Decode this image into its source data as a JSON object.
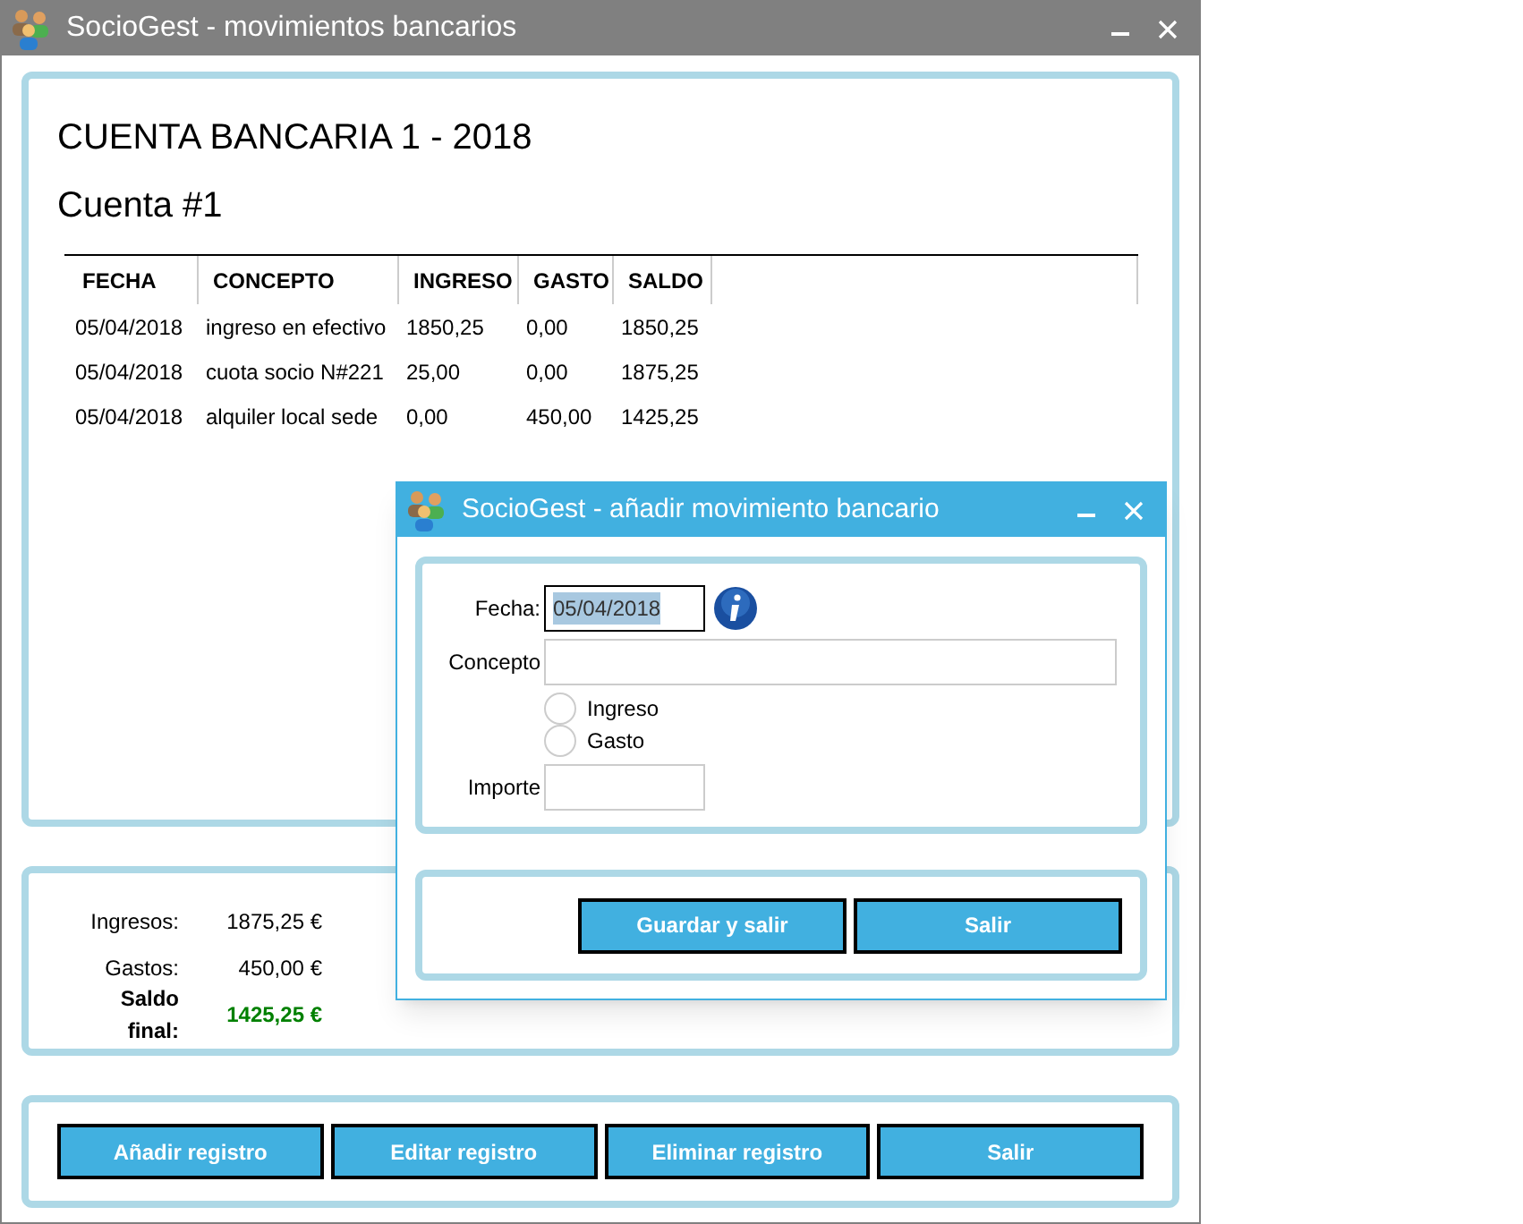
{
  "window": {
    "title": "SocioGest - movimientos bancarios"
  },
  "account_title": "CUENTA BANCARIA 1 - 2018",
  "account_subtitle": "Cuenta #1",
  "table": {
    "columns": [
      "FECHA",
      "CONCEPTO",
      "INGRESO",
      "GASTO",
      "SALDO"
    ],
    "rows": [
      [
        "05/04/2018",
        "ingreso en efectivo",
        "1850,25",
        "0,00",
        "1850,25"
      ],
      [
        "05/04/2018",
        "cuota socio N#221",
        "25,00",
        "0,00",
        "1875,25"
      ],
      [
        "05/04/2018",
        "alquiler local sede",
        "0,00",
        "450,00",
        "1425,25"
      ]
    ]
  },
  "summary": [
    {
      "label": "Ingresos:",
      "value": "1875,25 €",
      "kind": "normal"
    },
    {
      "label": "Gastos:",
      "value": "450,00 €",
      "kind": "normal"
    },
    {
      "label": "Saldo final:",
      "value": "1425,25 €",
      "kind": "total"
    }
  ],
  "buttons": [
    "Añadir registro",
    "Editar registro",
    "Eliminar registro",
    "Salir"
  ],
  "dialog": {
    "title": "SocioGest - añadir movimiento bancario",
    "fecha_label": "Fecha:",
    "fecha_value": "05/04/2018",
    "concepto_label": "Concepto",
    "radios": [
      {
        "label": "Ingreso",
        "selected": false
      },
      {
        "label": "Gasto",
        "selected": false
      }
    ],
    "importe_label": "Importe",
    "buttons": [
      "Guardar y salir",
      "Salir"
    ]
  }
}
